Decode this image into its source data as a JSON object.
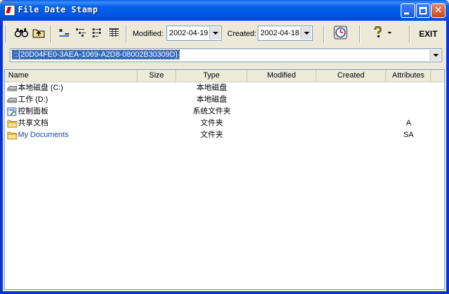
{
  "window": {
    "title": "File Date Stamp"
  },
  "toolbar": {
    "modified_label": "Modified:",
    "modified_value": "2002-04-19",
    "created_label": "Created:",
    "created_value": "2002-04-18",
    "exit_label": "EXIT",
    "icons": [
      "binoculars-icon",
      "up-folder-icon",
      "large-icons-view-icon",
      "small-icons-view-icon",
      "list-view-icon",
      "details-view-icon",
      "clock-icon",
      "help-icon"
    ]
  },
  "address": {
    "value": "::{20D04FE0-3AEA-1069-A2D8-08002B30309D}"
  },
  "list": {
    "columns": [
      "Name",
      "Size",
      "Type",
      "Modified",
      "Created",
      "Attributes"
    ],
    "rows": [
      {
        "name": "本地磁盘 (C:)",
        "size": "",
        "type": "本地磁盘",
        "modified": "",
        "created": "",
        "attributes": "",
        "icon": "drive-icon"
      },
      {
        "name": "工作 (D:)",
        "size": "",
        "type": "本地磁盘",
        "modified": "",
        "created": "",
        "attributes": "",
        "icon": "drive-icon"
      },
      {
        "name": "控制面板",
        "size": "",
        "type": "系统文件夹",
        "modified": "",
        "created": "",
        "attributes": "",
        "icon": "control-panel-icon"
      },
      {
        "name": "共享文档",
        "size": "",
        "type": "文件夹",
        "modified": "",
        "created": "",
        "attributes": "A",
        "icon": "folder-icon"
      },
      {
        "name": "My Documents",
        "size": "",
        "type": "文件夹",
        "modified": "",
        "created": "",
        "attributes": "SA",
        "icon": "folder-icon"
      }
    ]
  }
}
